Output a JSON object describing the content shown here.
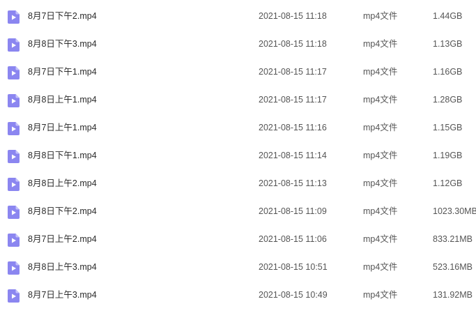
{
  "files": [
    {
      "name": "8月7日下午2.mp4",
      "date": "2021-08-15 11:18",
      "type": "mp4文件",
      "size": "1.44GB",
      "icon": "video-file-icon"
    },
    {
      "name": "8月8日下午3.mp4",
      "date": "2021-08-15 11:18",
      "type": "mp4文件",
      "size": "1.13GB",
      "icon": "video-file-icon"
    },
    {
      "name": "8月7日下午1.mp4",
      "date": "2021-08-15 11:17",
      "type": "mp4文件",
      "size": "1.16GB",
      "icon": "video-file-icon"
    },
    {
      "name": "8月8日上午1.mp4",
      "date": "2021-08-15 11:17",
      "type": "mp4文件",
      "size": "1.28GB",
      "icon": "video-file-icon"
    },
    {
      "name": "8月7日上午1.mp4",
      "date": "2021-08-15 11:16",
      "type": "mp4文件",
      "size": "1.15GB",
      "icon": "video-file-icon"
    },
    {
      "name": "8月8日下午1.mp4",
      "date": "2021-08-15 11:14",
      "type": "mp4文件",
      "size": "1.19GB",
      "icon": "video-file-icon"
    },
    {
      "name": "8月8日上午2.mp4",
      "date": "2021-08-15 11:13",
      "type": "mp4文件",
      "size": "1.12GB",
      "icon": "video-file-icon"
    },
    {
      "name": "8月8日下午2.mp4",
      "date": "2021-08-15 11:09",
      "type": "mp4文件",
      "size": "1023.30MB",
      "icon": "video-file-icon"
    },
    {
      "name": "8月7日上午2.mp4",
      "date": "2021-08-15 11:06",
      "type": "mp4文件",
      "size": "833.21MB",
      "icon": "video-file-icon"
    },
    {
      "name": "8月8日上午3.mp4",
      "date": "2021-08-15 10:51",
      "type": "mp4文件",
      "size": "523.16MB",
      "icon": "video-file-icon"
    },
    {
      "name": "8月7日上午3.mp4",
      "date": "2021-08-15 10:49",
      "type": "mp4文件",
      "size": "131.92MB",
      "icon": "video-file-icon"
    }
  ],
  "colors": {
    "icon_body": "#8b86f0",
    "icon_fold": "#c4c1fa",
    "icon_play": "#ffffff"
  }
}
